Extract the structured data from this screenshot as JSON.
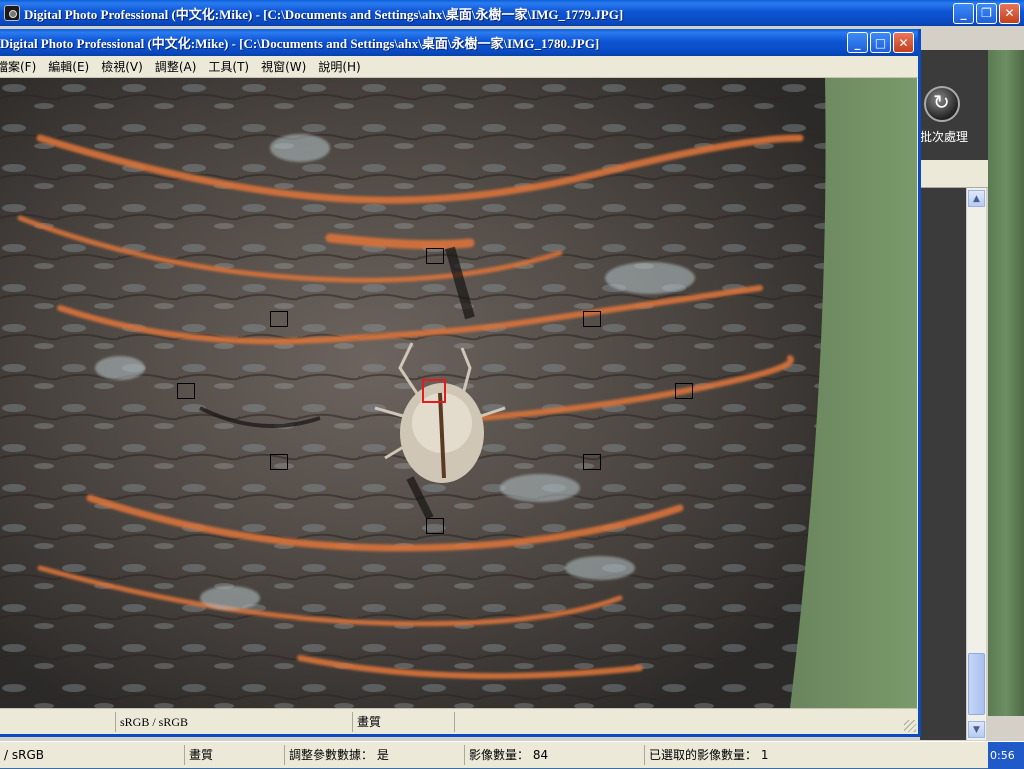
{
  "main_window": {
    "title": "Digital Photo Professional (中文化:Mike) - [C:\\Documents and Settings\\ahx\\桌面\\永樹一家\\IMG_1779.JPG]",
    "process_label": "批次處理",
    "status": {
      "color_space": "/ sRGB",
      "quality": "畫質",
      "recipe": "調整參數數據： 是",
      "image_count": "影像數量： 84",
      "selected_count": "已選取的影像數量： 1",
      "clock": "0:56"
    }
  },
  "viewer_window": {
    "title": "Digital Photo Professional (中文化:Mike) - [C:\\Documents and Settings\\ahx\\桌面\\永樹一家\\IMG_1780.JPG]",
    "menu": [
      "檔案(F)",
      "編輯(E)",
      "檢視(V)",
      "調整(A)",
      "工具(T)",
      "視窗(W)",
      "說明(H)"
    ],
    "status": {
      "blank": "",
      "color_space": "sRGB / sRGB",
      "quality": "畫質"
    }
  },
  "photo": {
    "subject": "cicada-shell-on-tree-bark",
    "af_points_count": 9,
    "selected_af_point": "center"
  },
  "colors": {
    "titlebar_blue": "#0a4bc4",
    "af_selected": "#e21b1b",
    "af_normal": "#000000",
    "bark_orange": "#d9733a"
  },
  "icons": {
    "minimize": "minimize-icon",
    "maximize": "maximize-icon",
    "restore": "restore-icon",
    "close": "close-icon"
  }
}
